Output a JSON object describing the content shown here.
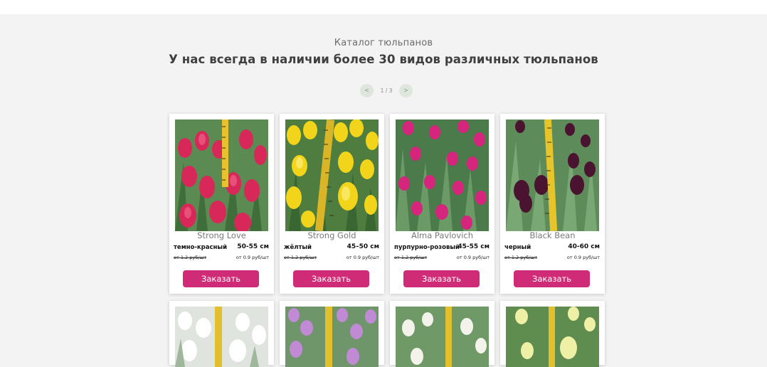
{
  "section": {
    "subtitle": "Каталог тюльпанов",
    "title": "У нас всегда в наличии более 30 видов различных тюльпанов"
  },
  "pager": {
    "prev_label": "<",
    "next_label": ">",
    "indicator": "1 / 3"
  },
  "products": [
    {
      "name": "Strong Love",
      "color": "темно-красный",
      "length": "50-55 см",
      "old_price": "от 1.2 руб/шт",
      "new_price": "от 0.9 руб/шт",
      "order_label": "Заказать",
      "image": "photo-red-tulips"
    },
    {
      "name": "Strong Gold",
      "color": "жёлтый",
      "length": "45–50 см",
      "old_price": "от 1.2 руб/шт",
      "new_price": "от 0.9 руб/шт",
      "order_label": "Заказать",
      "image": "photo-yellow-tulips"
    },
    {
      "name": "Alma Pavlovich",
      "color": "пурпурно-розовый",
      "length": "45-55 см",
      "old_price": "от 1.2 руб/шт",
      "new_price": "от 0.9 руб/шт",
      "order_label": "Заказать",
      "image": "photo-purple-pink-tulips"
    },
    {
      "name": "Black Bean",
      "color": "черный",
      "length": "40-60 см",
      "old_price": "от 1.2 руб/шт",
      "new_price": "от 0.9 руб/шт",
      "order_label": "Заказать",
      "image": "photo-dark-purple-tulips"
    }
  ],
  "next_row_images": [
    "photo-white-tulips",
    "photo-lilac-tulips",
    "photo-white-green-tulips",
    "photo-cream-yellow-tulips"
  ]
}
